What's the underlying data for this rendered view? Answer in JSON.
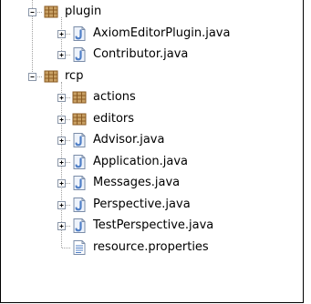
{
  "tree": {
    "items": [
      {
        "label": "plugin",
        "icon": "package-icon",
        "expanded": true,
        "depth": 0
      },
      {
        "label": "AxiomEditorPlugin.java",
        "icon": "java-file-icon",
        "expanded": false,
        "depth": 1
      },
      {
        "label": "Contributor.java",
        "icon": "java-file-icon",
        "expanded": false,
        "depth": 1
      },
      {
        "label": "rcp",
        "icon": "package-icon",
        "expanded": true,
        "depth": 0
      },
      {
        "label": "actions",
        "icon": "package-icon",
        "expanded": false,
        "depth": 1
      },
      {
        "label": "editors",
        "icon": "package-icon",
        "expanded": false,
        "depth": 1
      },
      {
        "label": "Advisor.java",
        "icon": "java-file-icon",
        "expanded": false,
        "depth": 1
      },
      {
        "label": "Application.java",
        "icon": "java-file-icon",
        "expanded": false,
        "depth": 1
      },
      {
        "label": "Messages.java",
        "icon": "java-file-icon",
        "expanded": false,
        "depth": 1
      },
      {
        "label": "Perspective.java",
        "icon": "java-file-icon",
        "expanded": false,
        "depth": 1
      },
      {
        "label": "TestPerspective.java",
        "icon": "java-file-icon",
        "expanded": false,
        "depth": 1
      },
      {
        "label": "resource.properties",
        "icon": "properties-file-icon",
        "expanded": null,
        "depth": 1
      }
    ]
  },
  "colors": {
    "package": "#c8a064",
    "package_dark": "#8a5a22",
    "java_file": "#4f7fc7",
    "file_border": "#7a8ca8"
  }
}
